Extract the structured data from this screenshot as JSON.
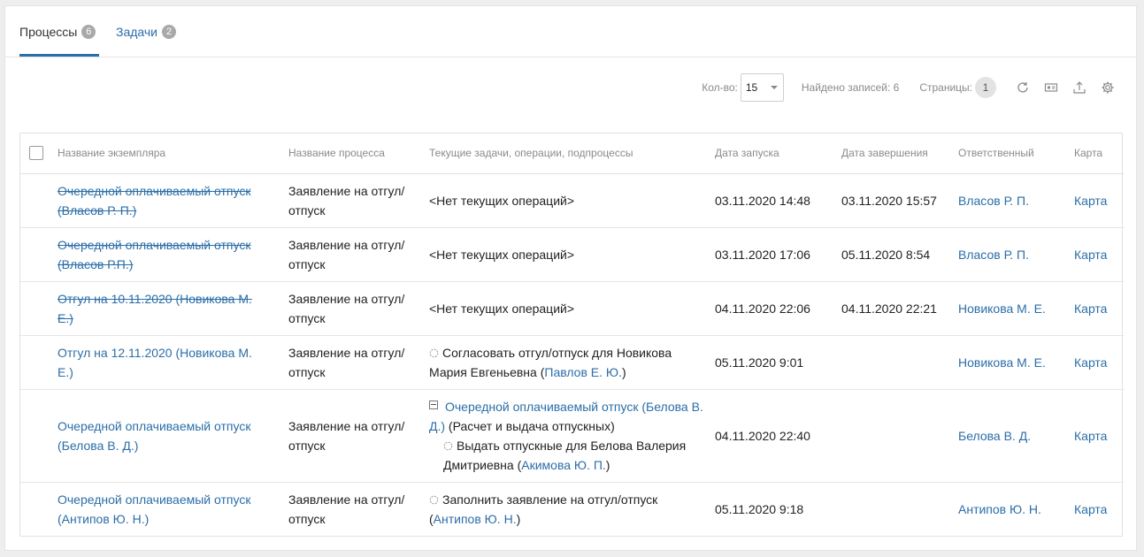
{
  "tabs": [
    {
      "label": "Процессы",
      "count": "6"
    },
    {
      "label": "Задачи",
      "count": "2"
    }
  ],
  "toolbar": {
    "count_label": "Кол-во:",
    "count_value": "15",
    "found_label": "Найдено записей: 6",
    "pages_label": "Страницы:",
    "page_current": "1",
    "icons": [
      "refresh-icon",
      "card-view-icon",
      "export-icon",
      "settings-icon"
    ]
  },
  "table": {
    "headers": {
      "instance": "Название экземпляра",
      "process": "Название процесса",
      "tasks": "Текущие задачи, операции, подпроцессы",
      "start": "Дата запуска",
      "end": "Дата завершения",
      "responsible": "Ответственный",
      "map": "Карта"
    },
    "rows": [
      {
        "instance": "Очередной оплачиваемый отпуск (Власов Р. П.)",
        "process": "Заявление на отгул/отпуск",
        "task": "<Нет текущих операций>",
        "start": "03.11.2020 14:48",
        "end": "03.11.2020 15:57",
        "responsible": "Власов Р. П.",
        "map": "Карта"
      },
      {
        "instance": "Очередной оплачиваемый отпуск (Власов Р.П.)",
        "process": "Заявление на отгул/отпуск",
        "task": "<Нет текущих операций>",
        "start": "03.11.2020 17:06",
        "end": "05.11.2020 8:54",
        "responsible": "Власов Р. П.",
        "map": "Карта"
      },
      {
        "instance": "Отгул на 10.11.2020 (Новикова М. Е.)",
        "process": "Заявление на отгул/отпуск",
        "task": "<Нет текущих операций>",
        "start": "04.11.2020 22:06",
        "end": "04.11.2020 22:21",
        "responsible": "Новикова М. Е.",
        "map": "Карта"
      },
      {
        "instance": "Отгул на 12.11.2020 (Новикова М. Е.)",
        "process": "Заявление на отгул/отпуск",
        "task_text": "Согласовать отгул/отпуск для Новикова Мария Евгеньевна (",
        "task_person": "Павлов Е. Ю.",
        "task_close": ")",
        "start": "05.11.2020 9:01",
        "end": "",
        "responsible": "Новикова М. Е.",
        "map": "Карта"
      },
      {
        "instance": "Очередной оплачиваемый отпуск (Белова В. Д.)",
        "process": "Заявление на отгул/отпуск",
        "sub_link": "Очередной оплачиваемый отпуск (Белова В. Д.)",
        "sub_text": " (Расчет и выдача отпускных)",
        "task_text": "Выдать отпускные для Белова Валерия Дмитриевна (",
        "task_person": "Акимова Ю. П.",
        "task_close": ")",
        "start": "04.11.2020 22:40",
        "end": "",
        "responsible": "Белова В. Д.",
        "map": "Карта"
      },
      {
        "instance": "Очередной оплачиваемый отпуск (Антипов Ю. Н.)",
        "process": "Заявление на отгул/отпуск",
        "task_text": "Заполнить заявление на отгул/отпуск (",
        "task_person": "Антипов Ю. Н.",
        "task_close": ")",
        "start": "05.11.2020 9:18",
        "end": "",
        "responsible": "Антипов Ю. Н.",
        "map": "Карта"
      }
    ]
  },
  "colors": {
    "link": "#2b6ea8",
    "tab_underline": "#2b6ea8",
    "badge": "#a9a9a9"
  }
}
